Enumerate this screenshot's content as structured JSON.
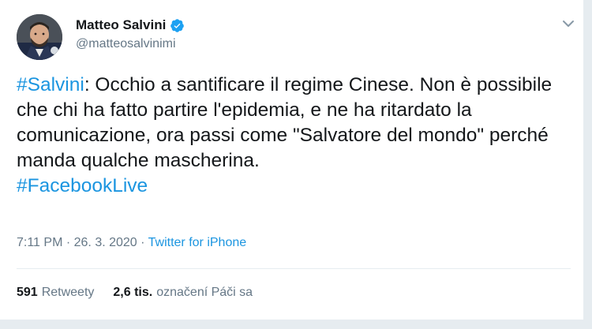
{
  "user": {
    "display_name": "Matteo Salvini",
    "handle": "@matteosalvinimi",
    "verified": true,
    "avatar_icon": "avatar-photo"
  },
  "tweet": {
    "hashtag_1": "#Salvini",
    "body": ": Occhio a santificare il regime Cinese. Non è possibile che chi ha fatto partire l'epidemia, e ne ha ritardato la comunicazione, ora passi come \"Salvatore del mondo\" perché manda qualche mascherina.",
    "hashtag_2": "#FacebookLive"
  },
  "meta": {
    "time": "7:11 PM",
    "separator_1": " · ",
    "date": "26. 3. 2020",
    "separator_2": " · ",
    "source": "Twitter for iPhone"
  },
  "stats": {
    "retweets_count": "591",
    "retweets_label": "Retweety",
    "likes_count": "2,6 tis.",
    "likes_label": "označení Páči sa"
  },
  "colors": {
    "accent": "#1b95e0",
    "verified": "#1da1f2",
    "text": "#14171a",
    "muted": "#657786"
  }
}
